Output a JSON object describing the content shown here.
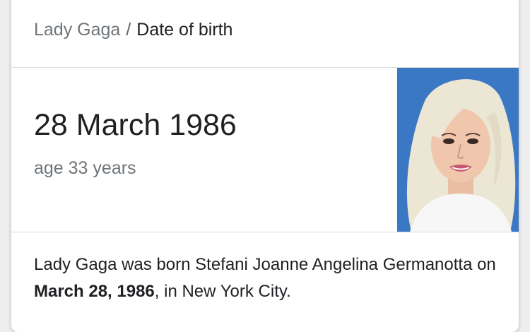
{
  "breadcrumb": {
    "entity": "Lady Gaga",
    "separator": "/",
    "attribute": "Date of birth"
  },
  "answer": {
    "value": "28 March 1986",
    "subtext": "age 33 years"
  },
  "photo": {
    "icon": "person-portrait"
  },
  "description": {
    "part1": "Lady Gaga was born Stefani Joanne Angelina Germanotta on ",
    "bold": "March 28, 1986",
    "part2": ", in New York City."
  },
  "colors": {
    "photo_background": "#3a78c4",
    "hair": "#ece6d4",
    "skin": "#f0c7ad",
    "lips": "#c9566f"
  }
}
